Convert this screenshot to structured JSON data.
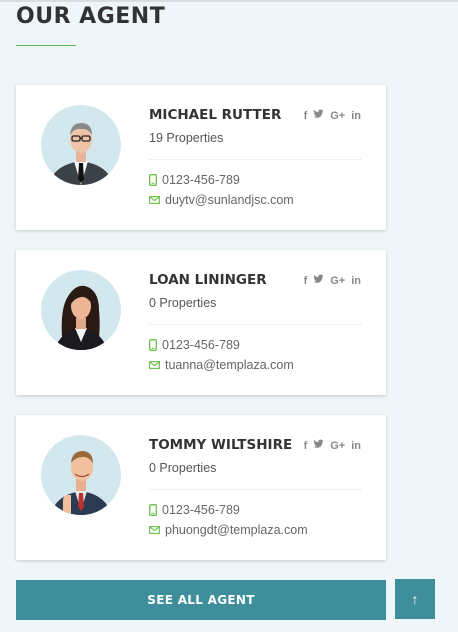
{
  "section": {
    "title": "OUR AGENT"
  },
  "agents": [
    {
      "name": "MICHAEL RUTTER",
      "properties": "19 Properties",
      "phone": "0123-456-789",
      "email": "duytv@sunlandjsc.com"
    },
    {
      "name": "LOAN LININGER",
      "properties": "0 Properties",
      "phone": "0123-456-789",
      "email": "tuanna@templaza.com"
    },
    {
      "name": "TOMMY WILTSHIRE",
      "properties": "0 Properties",
      "phone": "0123-456-789",
      "email": "phuongdt@templaza.com"
    }
  ],
  "social_icons": {
    "facebook": "f",
    "twitter": "twitter-bird",
    "google_plus": "G+",
    "linkedin": "in"
  },
  "buttons": {
    "see_all": "SEE ALL AGENT",
    "back_to_top": "↑"
  },
  "colors": {
    "accent": "#3e8e9c",
    "underline": "#5cb85c",
    "phone_icon": "#6cbf4a",
    "email_icon": "#6cbf4a"
  }
}
